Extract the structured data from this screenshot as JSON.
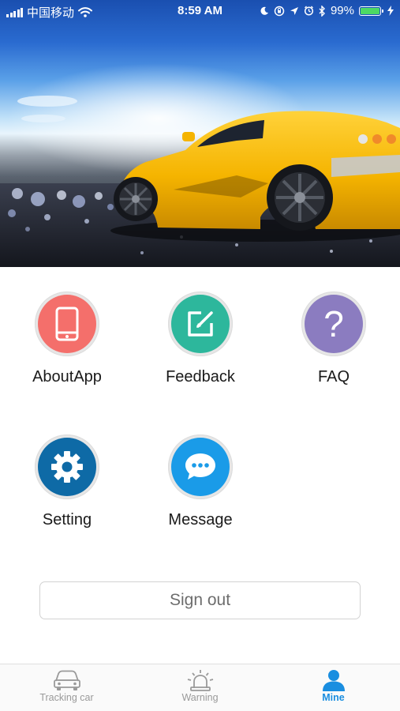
{
  "status_bar": {
    "carrier": "中国移动",
    "time": "8:59 AM",
    "battery_percent": "99%",
    "battery_level": 0.99,
    "icons": [
      "signal-icon",
      "wifi-icon",
      "moon-icon",
      "lock-rotation-icon",
      "location-icon",
      "alarm-icon",
      "bluetooth-icon",
      "battery-icon",
      "charging-icon"
    ]
  },
  "hero": {
    "image": "yellow-sports-car-banner"
  },
  "menu": {
    "items": [
      {
        "label": "AboutApp",
        "icon": "phone-icon",
        "color": "#f46f6b"
      },
      {
        "label": "Feedback",
        "icon": "edit-icon",
        "color": "#2db79c"
      },
      {
        "label": "FAQ",
        "icon": "question-icon",
        "color": "#8b7cc0"
      },
      {
        "label": "Setting",
        "icon": "gear-icon",
        "color": "#0e6aa6"
      },
      {
        "label": "Message",
        "icon": "chat-icon",
        "color": "#1a9be8"
      }
    ]
  },
  "signout": {
    "label": "Sign out"
  },
  "tab_bar": {
    "tabs": [
      {
        "label": "Tracking car",
        "icon": "car-icon",
        "active": false
      },
      {
        "label": "Warning",
        "icon": "siren-icon",
        "active": false
      },
      {
        "label": "Mine",
        "icon": "person-icon",
        "active": true
      }
    ],
    "active_color": "#1a8ee0",
    "inactive_color": "#9a9a9a"
  }
}
